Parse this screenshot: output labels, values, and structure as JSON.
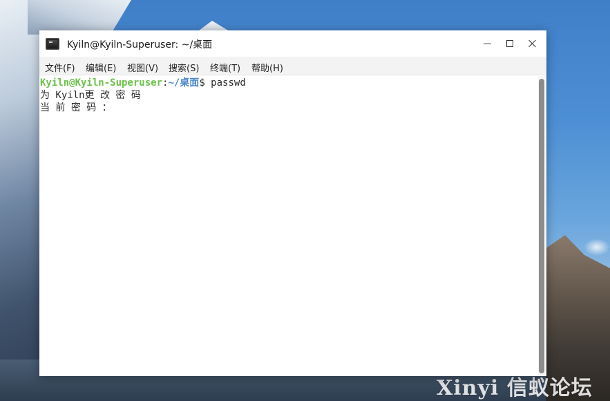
{
  "window": {
    "title": "Kyiln@Kyiln-Superuser: ~/桌面",
    "app_icon": "terminal-icon",
    "controls": {
      "minimize_icon": "minimize-icon",
      "maximize_icon": "maximize-icon",
      "close_icon": "close-icon"
    }
  },
  "menubar": {
    "items": [
      {
        "label": "文件(F)"
      },
      {
        "label": "编辑(E)"
      },
      {
        "label": "视图(V)"
      },
      {
        "label": "搜索(S)"
      },
      {
        "label": "终端(T)"
      },
      {
        "label": "帮助(H)"
      }
    ]
  },
  "terminal": {
    "prompt": {
      "user_host": "Kyiln@Kyiln-Superuser",
      "separator": ":",
      "path": "~/桌面",
      "symbol": "$",
      "command": " passwd"
    },
    "output": [
      "为 Kyiln更 改 密 码",
      "当 前 密 码 ："
    ]
  },
  "watermark": {
    "text": "Xinyi 信蚁论坛"
  },
  "colors": {
    "prompt_user": "#6cc24a",
    "prompt_path": "#4a86c8",
    "menubar_bg": "#f3f3f3",
    "terminal_bg": "#ffffff",
    "scrollbar_thumb": "#8c8c8c"
  }
}
